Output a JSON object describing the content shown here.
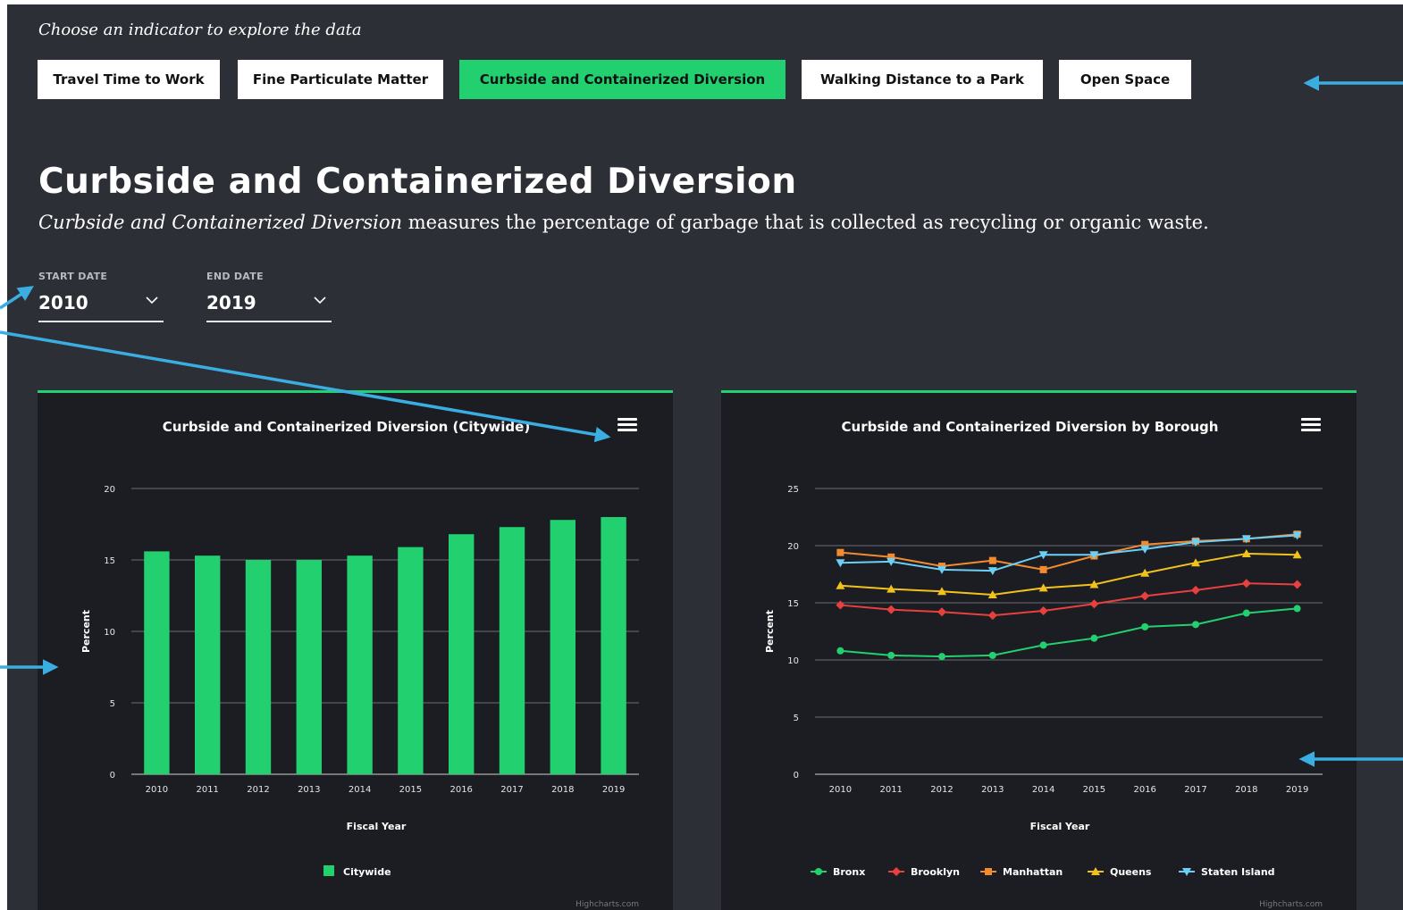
{
  "prompt": "Choose an indicator to explore the data",
  "tabs": [
    {
      "label": "Travel Time to Work",
      "active": false
    },
    {
      "label": "Fine Particulate Matter",
      "active": false
    },
    {
      "label": "Curbside and Containerized Diversion",
      "active": true
    },
    {
      "label": "Walking Distance to a Park",
      "active": false
    },
    {
      "label": "Open Space",
      "active": false
    }
  ],
  "heading": "Curbside and Containerized Diversion",
  "description": {
    "term": "Curbside and Containerized Diversion",
    "text": " measures the percentage of garbage that is collected as recycling or organic waste."
  },
  "start_date": {
    "label": "START DATE",
    "value": "2010"
  },
  "end_date": {
    "label": "END DATE",
    "value": "2019"
  },
  "colors": {
    "accent": "#23d06f",
    "background": "#2d2f37",
    "panel": "#1c1d22",
    "annotation_arrow": "#3aaee0",
    "Bronx": "#23d06f",
    "Brooklyn": "#e8403f",
    "Manhattan": "#f28b30",
    "Queens": "#f2c21c",
    "Staten Island": "#6ccff6"
  },
  "chart_data": [
    {
      "type": "bar",
      "title": "Curbside and Containerized Diversion (Citywide)",
      "xlabel": "Fiscal Year",
      "ylabel": "Percent",
      "ylim": [
        0,
        20
      ],
      "yticks": [
        0,
        5,
        10,
        15,
        20
      ],
      "categories": [
        "2010",
        "2011",
        "2012",
        "2013",
        "2014",
        "2015",
        "2016",
        "2017",
        "2018",
        "2019"
      ],
      "series": [
        {
          "name": "Citywide",
          "marker": "square",
          "values": [
            15.6,
            15.3,
            15.0,
            15.0,
            15.3,
            15.9,
            16.8,
            17.3,
            17.8,
            18.0
          ]
        }
      ],
      "credit": "Highcharts.com",
      "grid": true,
      "legend": "bottom-center"
    },
    {
      "type": "line",
      "title": "Curbside and Containerized Diversion by Borough",
      "xlabel": "Fiscal Year",
      "ylabel": "Percent",
      "ylim": [
        0,
        25
      ],
      "yticks": [
        0,
        5,
        10,
        15,
        20,
        25
      ],
      "categories": [
        "2010",
        "2011",
        "2012",
        "2013",
        "2014",
        "2015",
        "2016",
        "2017",
        "2018",
        "2019"
      ],
      "series": [
        {
          "name": "Bronx",
          "marker": "circle",
          "values": [
            10.8,
            10.4,
            10.3,
            10.4,
            11.3,
            11.9,
            12.9,
            13.1,
            14.1,
            14.5
          ]
        },
        {
          "name": "Brooklyn",
          "marker": "diamond",
          "values": [
            14.8,
            14.4,
            14.2,
            13.9,
            14.3,
            14.9,
            15.6,
            16.1,
            16.7,
            16.6
          ]
        },
        {
          "name": "Manhattan",
          "marker": "square",
          "values": [
            19.4,
            19.0,
            18.2,
            18.7,
            17.9,
            19.1,
            20.1,
            20.4,
            20.6,
            21.0
          ]
        },
        {
          "name": "Queens",
          "marker": "triangle",
          "values": [
            16.5,
            16.2,
            16.0,
            15.7,
            16.3,
            16.6,
            17.6,
            18.5,
            19.3,
            19.2
          ]
        },
        {
          "name": "Staten Island",
          "marker": "triangle-down",
          "values": [
            18.5,
            18.6,
            17.9,
            17.8,
            19.2,
            19.2,
            19.7,
            20.3,
            20.6,
            20.9
          ]
        }
      ],
      "credit": "Highcharts.com",
      "grid": true,
      "legend": "bottom-center"
    }
  ]
}
